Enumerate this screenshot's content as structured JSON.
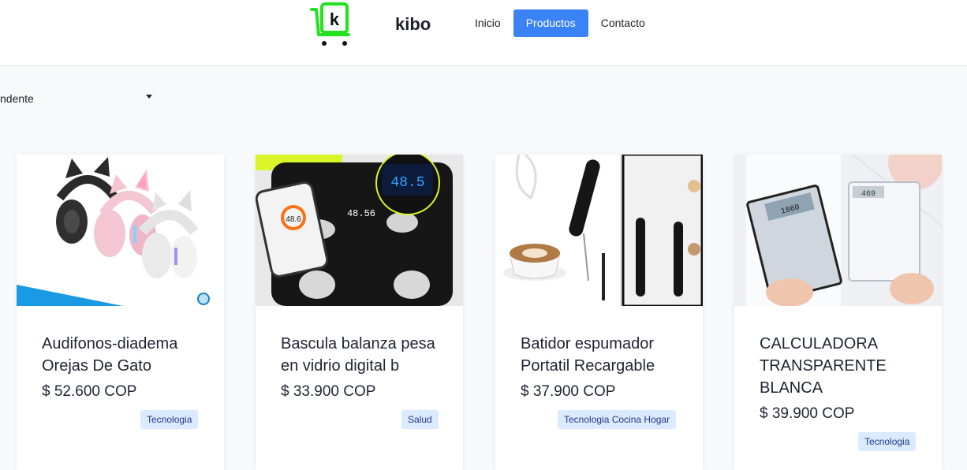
{
  "header": {
    "brand": "kibo",
    "logo_letter": "k",
    "nav": [
      "Inicio",
      "Productos",
      "Contacto"
    ],
    "active_nav": "Productos"
  },
  "sort": {
    "label": "ndente"
  },
  "products": [
    {
      "title": "Audifonos-diadema Orejas De Gato",
      "price": "$ 52.600 COP",
      "tag": "Tecnologia"
    },
    {
      "title": "Bascula balanza pesa en vidrio digital b",
      "price": "$ 33.900 COP",
      "tag": "Salud",
      "display": {
        "phone": "48.6",
        "scale": "48.56",
        "lcd": "48.5"
      }
    },
    {
      "title": "Batidor espumador Portatil Recargable",
      "price": "$ 37.900 COP",
      "tag": "Tecnologia Cocina Hogar"
    },
    {
      "title": "CALCULADORA TRANSPARENTE BLANCA",
      "price": "$ 39.900 COP",
      "tag": "Tecnologia",
      "display": {
        "calc1": "1860",
        "calc2": "469"
      }
    }
  ],
  "colors": {
    "accent": "#3b82f6",
    "tag_bg": "#dbeafe",
    "logo_green": "#22e31e"
  }
}
